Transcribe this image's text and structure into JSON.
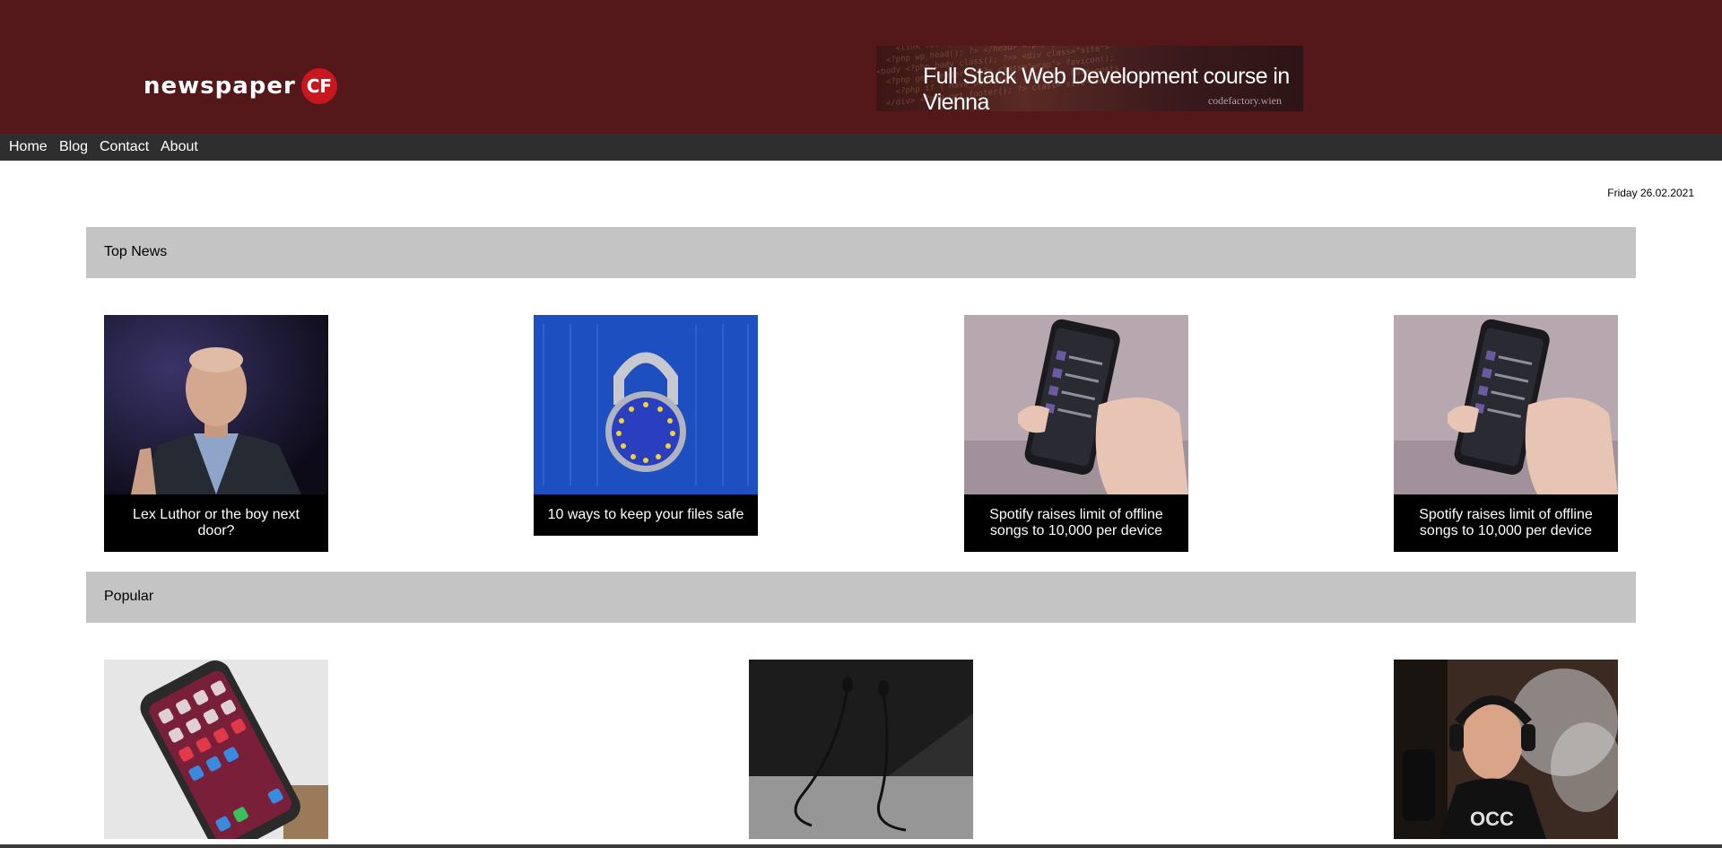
{
  "brand": {
    "name": "newspaper",
    "badge": "CF"
  },
  "banner": {
    "title": "Full Stack Web Development course in Vienna",
    "subtitle": "codefactory.wien"
  },
  "nav": {
    "items": [
      "Home",
      "Blog",
      "Contact",
      "About"
    ]
  },
  "date": "Friday 26.02.2021",
  "sections": {
    "top_news": {
      "title": "Top News",
      "cards": [
        {
          "caption": "Lex Luthor or the boy next door?"
        },
        {
          "caption": "10 ways to keep your files safe"
        },
        {
          "caption": "Spotify raises limit of offline songs to 10,000 per device"
        },
        {
          "caption": "Spotify raises limit of offline songs to 10,000 per device"
        }
      ]
    },
    "popular": {
      "title": "Popular"
    }
  },
  "colors": {
    "header_bg": "#54171a",
    "nav_bg": "#2e2e2e",
    "section_bg": "#c4c4c4",
    "badge": "#c8171e"
  }
}
